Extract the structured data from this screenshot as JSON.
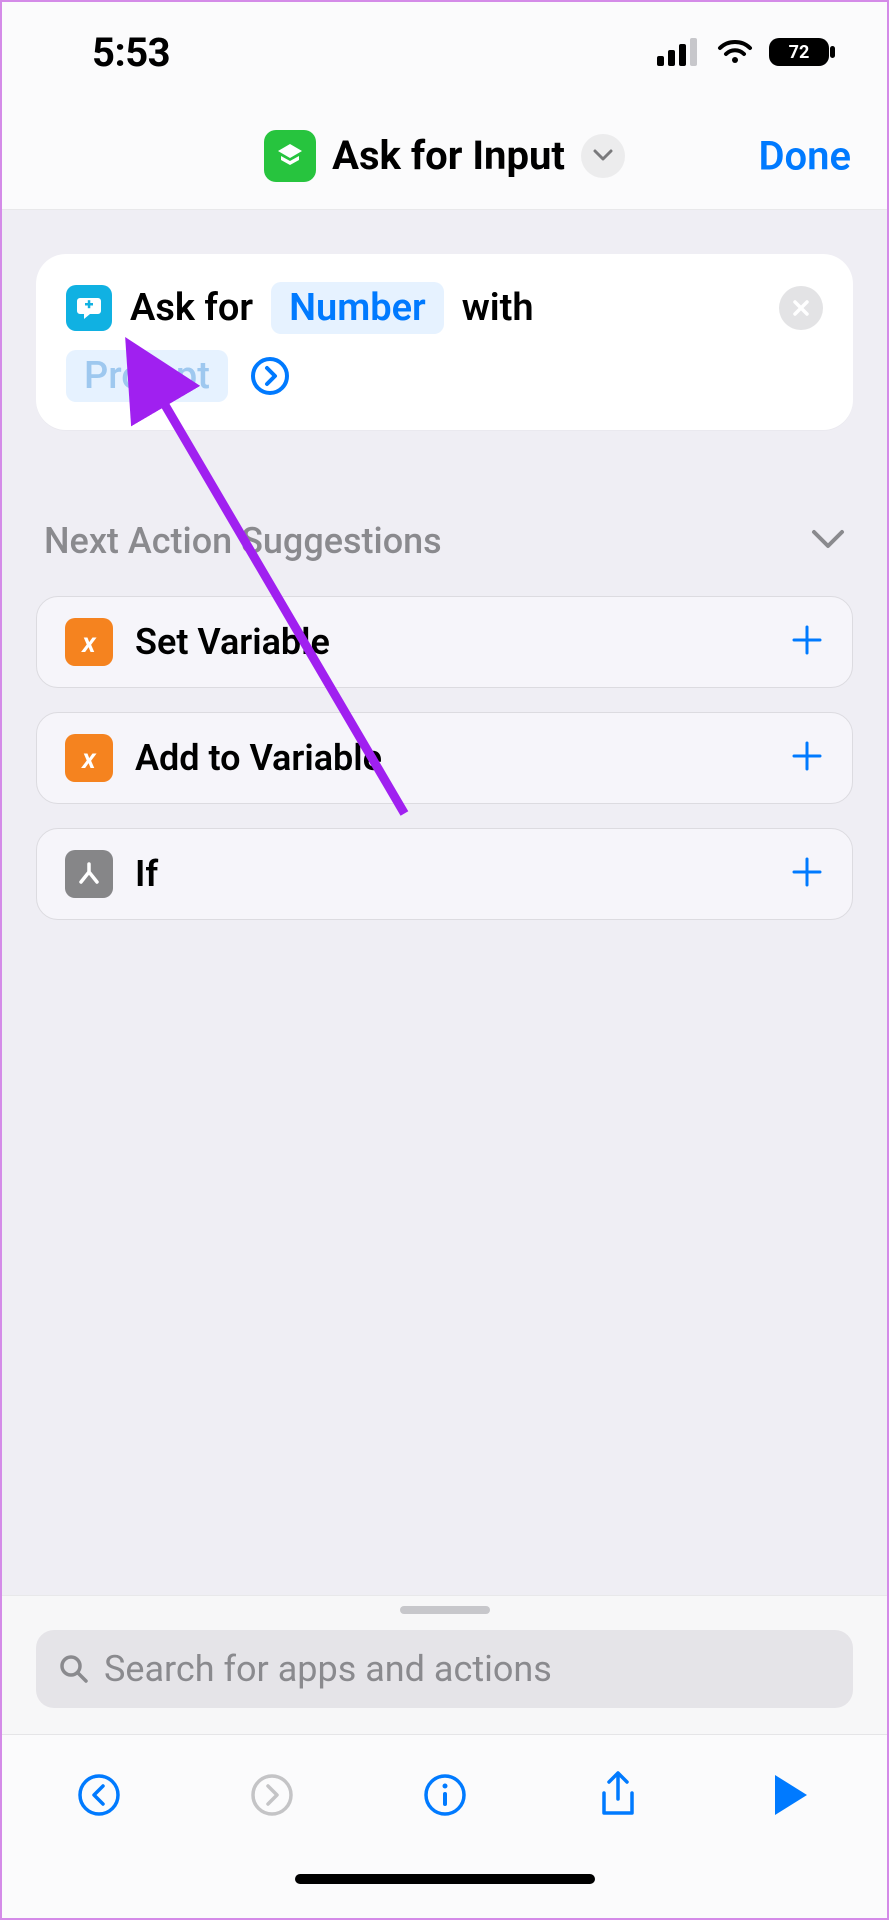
{
  "status": {
    "time": "5:53",
    "battery": "72"
  },
  "header": {
    "title": "Ask for Input",
    "done": "Done"
  },
  "action": {
    "prefix": "Ask for",
    "input_type": "Number",
    "with": "with",
    "prompt_placeholder": "Prompt"
  },
  "suggestions": {
    "title": "Next Action Suggestions",
    "items": [
      {
        "label": "Set Variable"
      },
      {
        "label": "Add to Variable"
      },
      {
        "label": "If"
      }
    ]
  },
  "search": {
    "placeholder": "Search for apps and actions"
  }
}
